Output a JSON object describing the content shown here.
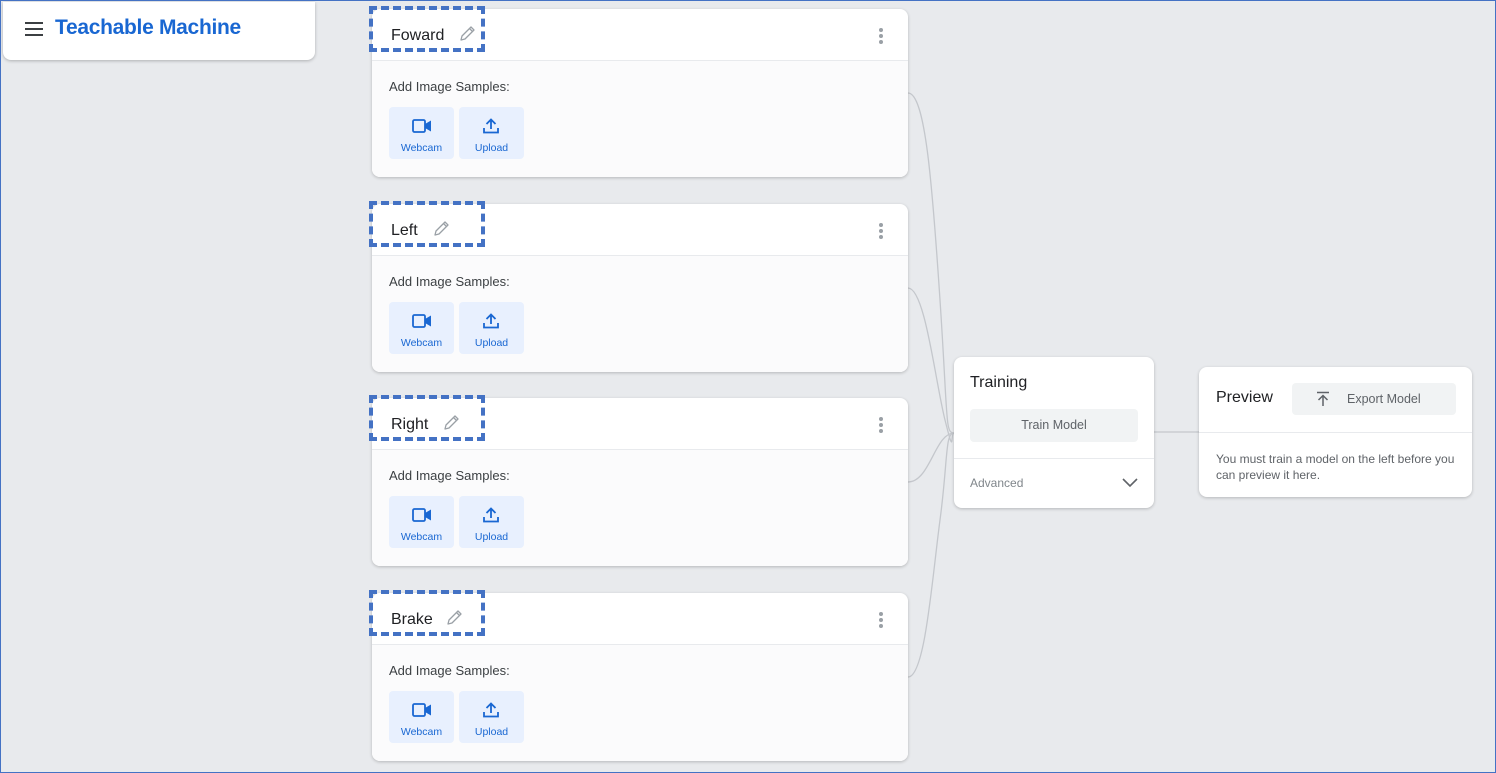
{
  "app": {
    "title": "Teachable Machine"
  },
  "icons": {
    "menu": "hamburger-menu-icon",
    "edit": "pencil-icon",
    "more": "kebab-menu-icon",
    "webcam": "video-camera-icon",
    "upload": "upload-arrow-icon",
    "export": "export-arrow-icon",
    "expand": "chevron-down-icon"
  },
  "colors": {
    "accent": "#1967d2",
    "highlight": "#4472c4",
    "background": "#e8eaed"
  },
  "classes": [
    {
      "name": "Foward",
      "samples_label": "Add Image Samples:",
      "webcam_label": "Webcam",
      "upload_label": "Upload"
    },
    {
      "name": "Left",
      "samples_label": "Add Image Samples:",
      "webcam_label": "Webcam",
      "upload_label": "Upload"
    },
    {
      "name": "Right",
      "samples_label": "Add Image Samples:",
      "webcam_label": "Webcam",
      "upload_label": "Upload"
    },
    {
      "name": "Brake",
      "samples_label": "Add Image Samples:",
      "webcam_label": "Webcam",
      "upload_label": "Upload"
    }
  ],
  "training": {
    "title": "Training",
    "train_button": "Train Model",
    "advanced_label": "Advanced"
  },
  "preview": {
    "title": "Preview",
    "export_button": "Export Model",
    "message": "You must train a model on the left before you can preview it here."
  }
}
